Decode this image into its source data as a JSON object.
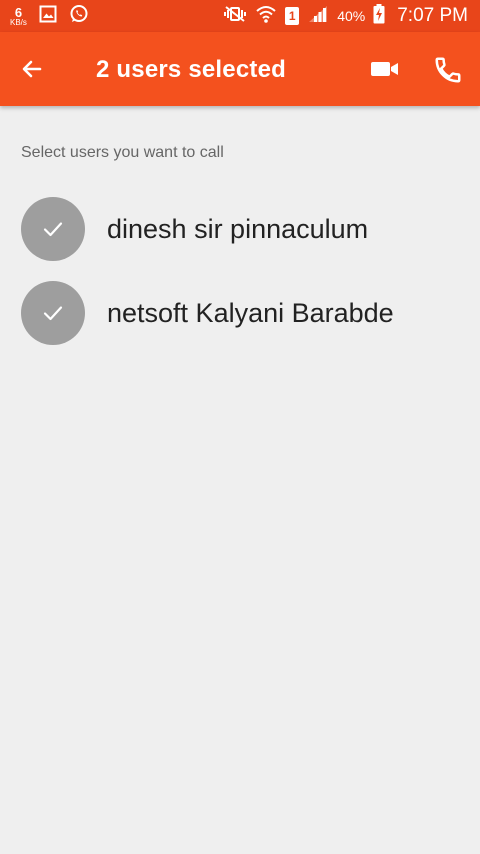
{
  "status_bar": {
    "net_speed_value": "6",
    "net_speed_unit": "KB/s",
    "sim_slot": "1",
    "battery_percent": "40%",
    "time": "7:07 PM"
  },
  "app_bar": {
    "title": "2 users selected"
  },
  "hint": "Select users you want to call",
  "users": [
    {
      "name": "dinesh sir pinnaculum",
      "selected": true
    },
    {
      "name": "netsoft Kalyani Barabde",
      "selected": true
    }
  ],
  "colors": {
    "accent": "#f4511e",
    "status_bar": "#e8451a",
    "background": "#efefef",
    "avatar": "#9e9e9e"
  }
}
